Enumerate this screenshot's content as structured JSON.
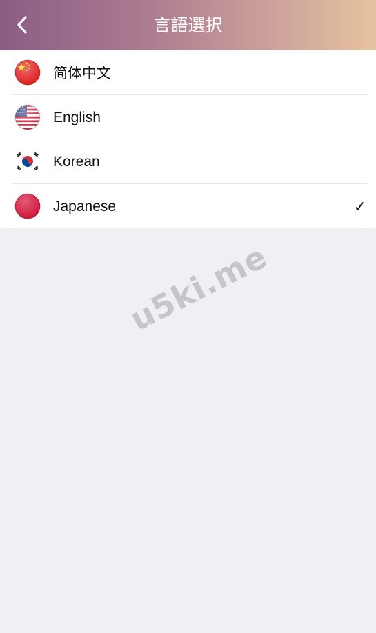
{
  "header": {
    "title": "言語選択",
    "back_icon": "chevron-left-icon",
    "gradient_start": "#8c5c86",
    "gradient_end": "#e6c3a0"
  },
  "languages": [
    {
      "label": "简体中文",
      "flag_icon": "china-flag-icon",
      "selected": false
    },
    {
      "label": "English",
      "flag_icon": "usa-flag-icon",
      "selected": false
    },
    {
      "label": "Korean",
      "flag_icon": "korea-flag-icon",
      "selected": false
    },
    {
      "label": "Japanese",
      "flag_icon": "japan-flag-icon",
      "selected": true
    }
  ],
  "selected_mark": "✓",
  "watermark": "u5ki.me"
}
